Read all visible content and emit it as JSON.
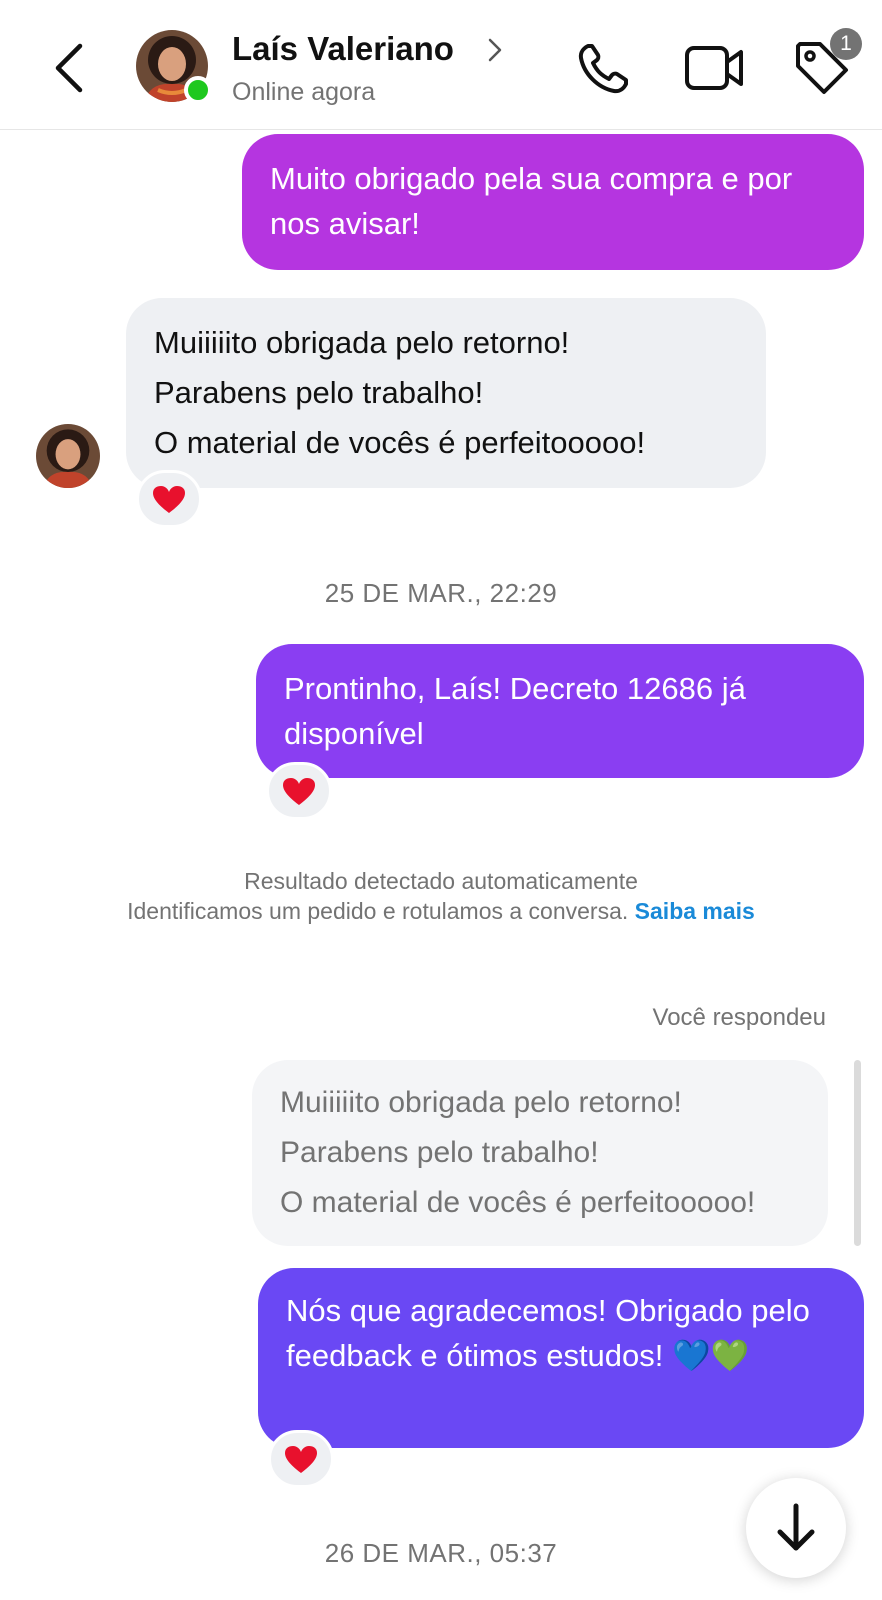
{
  "header": {
    "back_icon": "chevron-left-icon",
    "contact_name": "Laís Valeriano",
    "status": "Online agora",
    "call_icon": "phone-icon",
    "video_icon": "video-camera-icon",
    "tag_icon": "tag-icon",
    "tag_badge": "1"
  },
  "messages": [
    {
      "direction": "outgoing",
      "text": "Muito obrigado pela sua compra e por nos avisar!"
    },
    {
      "direction": "incoming",
      "lines": [
        "Muiiiiito obrigada pelo retorno!",
        "Parabens pelo trabalho!",
        "O material de vocês é perfeitooooo!"
      ],
      "reaction": "❤️"
    },
    {
      "direction": "outgoing",
      "text": "Prontinho, Laís! Decreto 12686 já disponível",
      "reaction": "❤️"
    },
    {
      "direction": "outgoing",
      "text": "Nós que agradecemos! Obrigado pelo feedback e ótimos estudos! 💙💚",
      "reaction": "❤️"
    }
  ],
  "timestamps": [
    "25 DE MAR., 22:29",
    "26 DE MAR., 05:37"
  ],
  "system_note": {
    "title": "Resultado detectado automaticamente",
    "body": "Identificamos um pedido e rotulamos a conversa.",
    "link": "Saiba mais"
  },
  "reply": {
    "label": "Você respondeu",
    "quoted_lines": [
      "Muiiiiito obrigada pelo retorno!",
      "Parabens pelo trabalho!",
      "O material de vocês é perfeitooooo!"
    ]
  },
  "scroll_icon": "arrow-down-icon",
  "colors": {
    "bubble_1": "#b535e0",
    "bubble_2": "#8a3ef2",
    "bubble_3": "#6a48f4",
    "incoming": "#eef0f3",
    "online": "#1ec81e",
    "link": "#1a8ad8"
  }
}
